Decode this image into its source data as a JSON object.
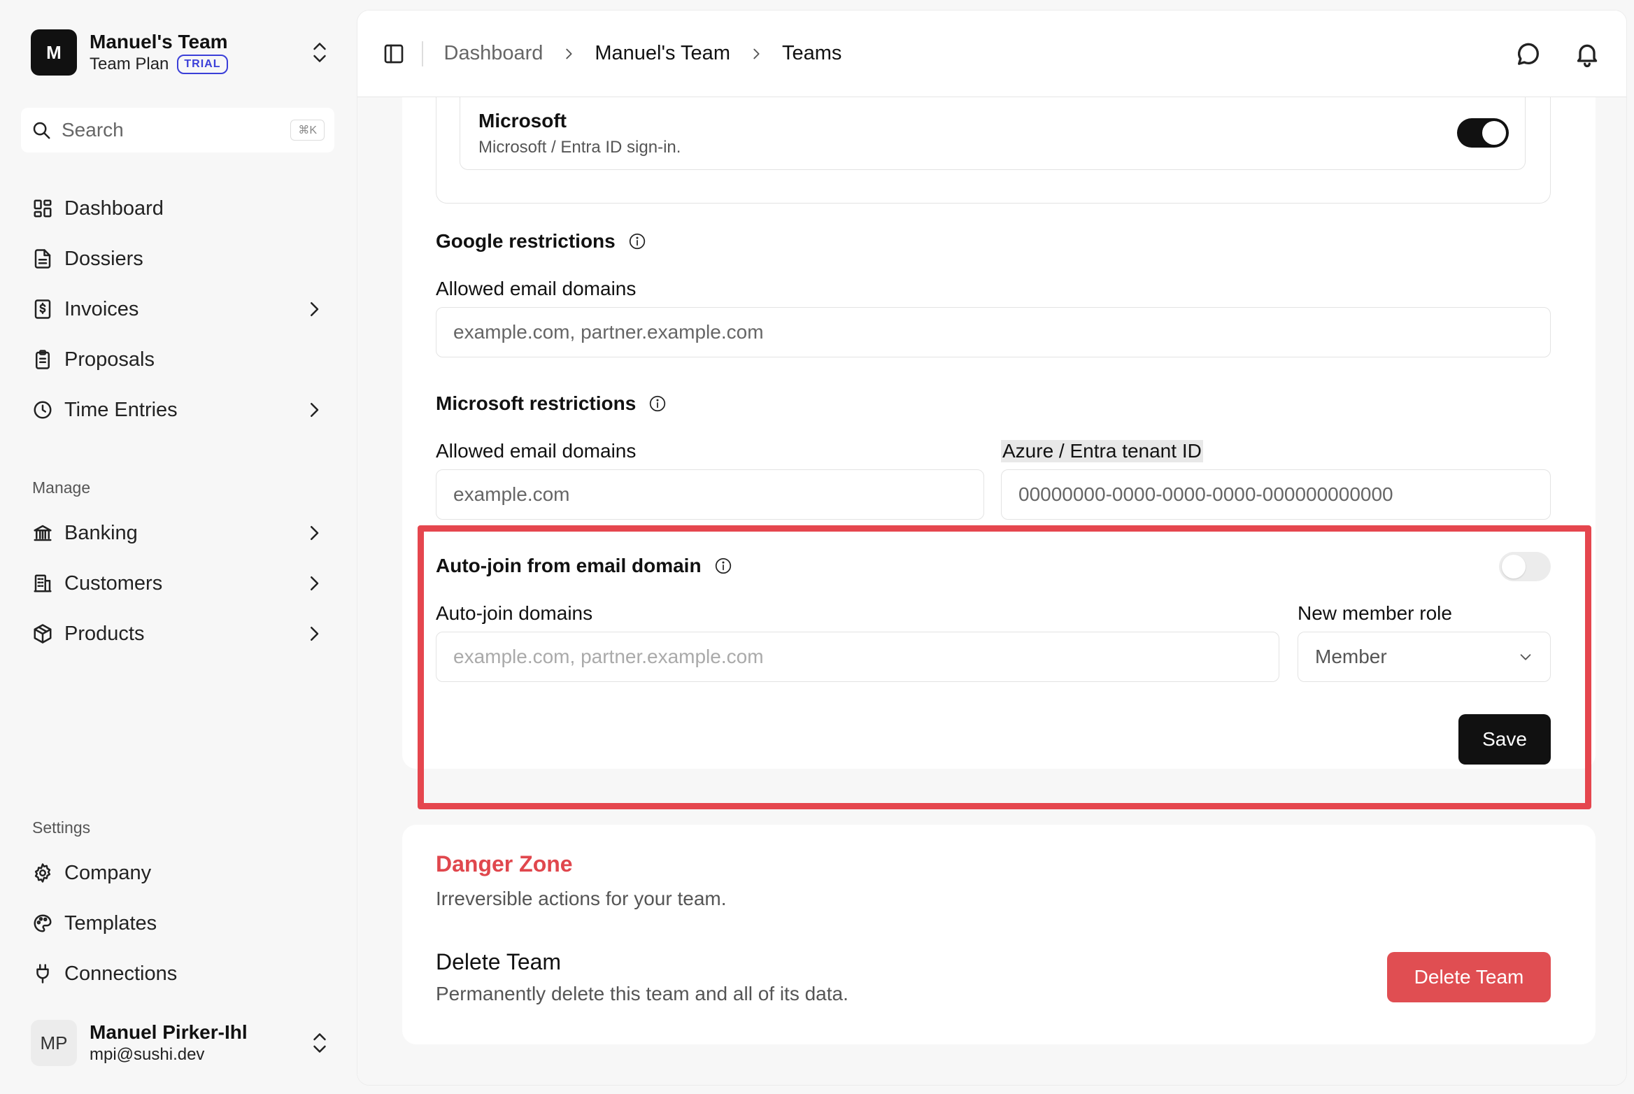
{
  "team": {
    "logo_letter": "M",
    "name": "Manuel's Team",
    "plan": "Team Plan",
    "badge": "TRIAL"
  },
  "search": {
    "label": "Search",
    "shortcut": "⌘K"
  },
  "nav_main": [
    {
      "label": "Dashboard",
      "icon": "dashboard-icon",
      "has_chevron": false
    },
    {
      "label": "Dossiers",
      "icon": "file-icon",
      "has_chevron": false
    },
    {
      "label": "Invoices",
      "icon": "invoice-icon",
      "has_chevron": true
    },
    {
      "label": "Proposals",
      "icon": "clipboard-icon",
      "has_chevron": false
    },
    {
      "label": "Time Entries",
      "icon": "clock-icon",
      "has_chevron": true
    }
  ],
  "manage": {
    "section_label": "Manage",
    "items": [
      {
        "label": "Banking",
        "icon": "bank-icon",
        "has_chevron": true
      },
      {
        "label": "Customers",
        "icon": "building-icon",
        "has_chevron": true
      },
      {
        "label": "Products",
        "icon": "box-icon",
        "has_chevron": true
      }
    ]
  },
  "settings": {
    "section_label": "Settings",
    "items": [
      {
        "label": "Company",
        "icon": "gear-icon"
      },
      {
        "label": "Templates",
        "icon": "palette-icon"
      },
      {
        "label": "Connections",
        "icon": "plug-icon"
      }
    ]
  },
  "user": {
    "initials": "MP",
    "name": "Manuel Pirker-Ihl",
    "email": "mpi@sushi.dev"
  },
  "breadcrumb": [
    "Dashboard",
    "Manuel's Team",
    "Teams"
  ],
  "provider": {
    "title": "Microsoft",
    "description": "Microsoft / Entra ID sign-in.",
    "enabled": true
  },
  "google_restrictions": {
    "heading": "Google restrictions",
    "domains_label": "Allowed email domains",
    "domains_placeholder": "example.com, partner.example.com"
  },
  "microsoft_restrictions": {
    "heading": "Microsoft restrictions",
    "domains_label": "Allowed email domains",
    "domains_placeholder": "example.com",
    "tenant_label": "Azure / Entra tenant ID",
    "tenant_placeholder": "00000000-0000-0000-0000-000000000000"
  },
  "autojoin": {
    "heading": "Auto-join from email domain",
    "enabled": false,
    "domains_label": "Auto-join domains",
    "domains_placeholder": "example.com, partner.example.com",
    "role_label": "New member role",
    "role_value": "Member",
    "save_label": "Save"
  },
  "danger": {
    "title": "Danger Zone",
    "description": "Irreversible actions for your team.",
    "delete_title": "Delete Team",
    "delete_description": "Permanently delete this team and all of its data.",
    "delete_button": "Delete Team"
  },
  "colors": {
    "accent_danger": "#e04e52",
    "highlight_frame": "#e5464e",
    "trial_badge": "#3b3fd8",
    "toggle_on": "#111111"
  }
}
